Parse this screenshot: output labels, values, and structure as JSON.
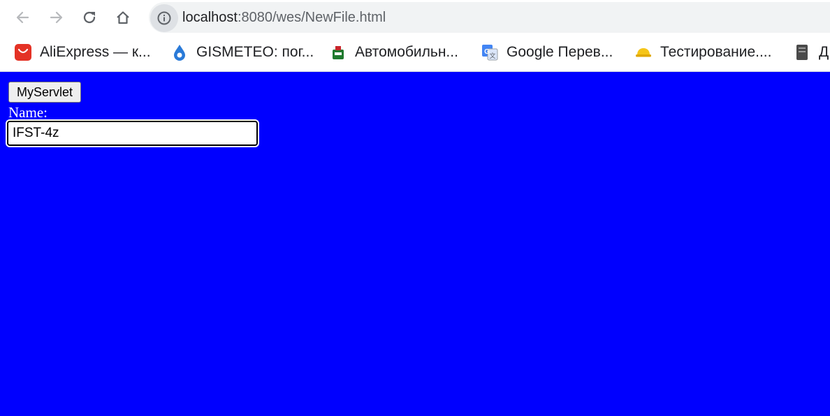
{
  "toolbar": {
    "back_icon": "arrow-left-icon",
    "forward_icon": "arrow-right-icon",
    "reload_icon": "reload-icon",
    "home_icon": "home-icon",
    "site_info_icon": "info-icon",
    "url_host": "localhost",
    "url_rest": ":8080/wes/NewFile.html"
  },
  "bookmarks": {
    "items": [
      {
        "label": "AliExpress — к...",
        "icon": "aliexpress-icon"
      },
      {
        "label": "GISMETEO: пог...",
        "icon": "gismeteo-drop-icon"
      },
      {
        "label": "Автомобильн...",
        "icon": "car-site-icon"
      },
      {
        "label": "Google Перев...",
        "icon": "google-translate-icon"
      },
      {
        "label": "Тестирование....",
        "icon": "hard-hat-icon"
      },
      {
        "label": "Д",
        "icon": "document-icon"
      }
    ]
  },
  "page": {
    "background": "#0000ff",
    "button_label": "MyServlet",
    "name_label": "Name:",
    "name_value": "IFST-4z"
  }
}
